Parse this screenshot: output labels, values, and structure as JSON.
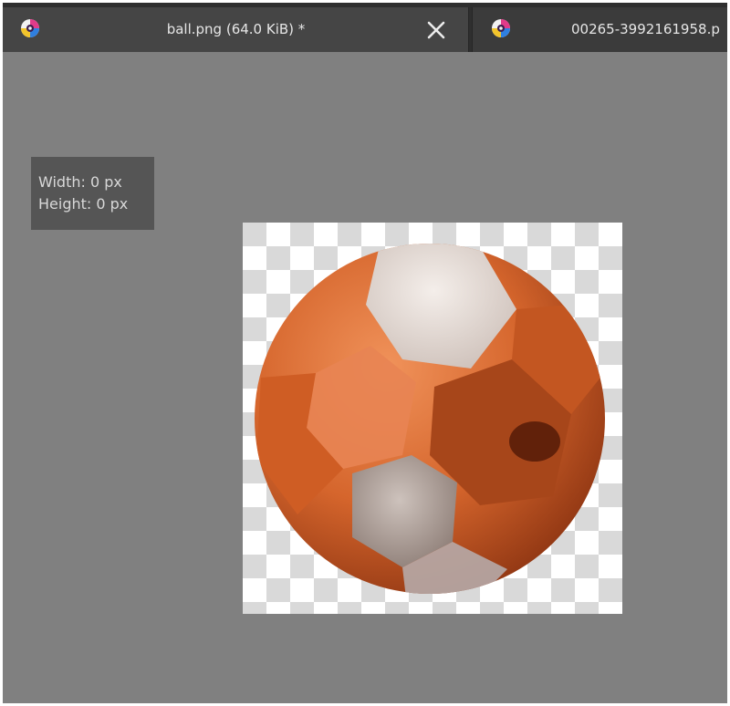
{
  "tabs": [
    {
      "title": "ball.png (64.0 KiB) *",
      "active": true,
      "icon": "krita-app-icon",
      "close_icon": "close-icon"
    },
    {
      "title": "00265-3992161958.p",
      "active": false,
      "icon": "krita-app-icon"
    }
  ],
  "size_tooltip": {
    "width_text": "Width: 0 px",
    "height_text": "Height: 0 px"
  },
  "colors": {
    "canvas_background": "#808080",
    "tabbar_background": "#2f2f2f",
    "active_tab": "#454545",
    "ball_orange": "#d9692e",
    "ball_panel_light": "#e2d9d4"
  }
}
